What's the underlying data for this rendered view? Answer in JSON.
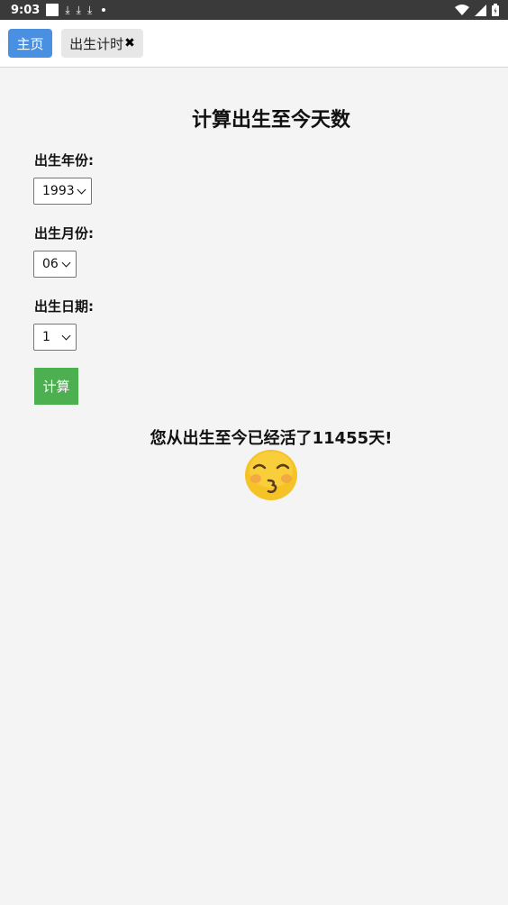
{
  "status_bar": {
    "time": "9:03"
  },
  "tabs": {
    "home_label": "主页",
    "timer_label": "出生计时",
    "close_glyph": "✖"
  },
  "main": {
    "title": "计算出生至今天数",
    "year_label": "出生年份:",
    "year_value": "1993",
    "month_label": "出生月份:",
    "month_value": "06",
    "day_label": "出生日期:",
    "day_value": "1",
    "calculate_label": "计算",
    "result": "您从出生至今已经活了11455天!"
  },
  "icons": {
    "result_emoji": "kissing-face-icon",
    "emoji_color": "#f5c326"
  },
  "colors": {
    "home_tab": "#4a90e2",
    "calculate_button": "#4caf50"
  }
}
